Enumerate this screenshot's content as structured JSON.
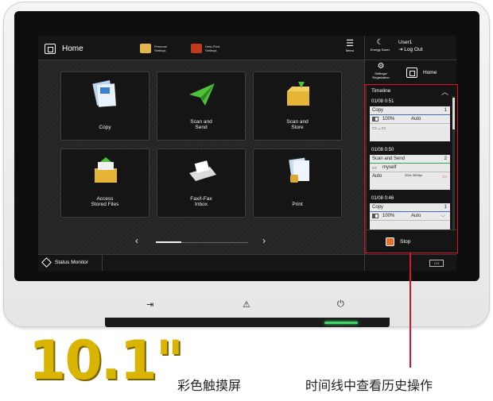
{
  "topbar": {
    "home_label": "Home",
    "personal_settings": "Personal Settings",
    "dest_fwd_settings": "Dest./Fwd. Settings",
    "menu_label": "Menu"
  },
  "session": {
    "energy_saver": "Energy Saver",
    "user": "User1",
    "logout": "Log Out",
    "settings_registration": "Settings/ Registration",
    "home_label": "Home"
  },
  "tiles": [
    {
      "label": "Copy"
    },
    {
      "label": "Scan and\nSend"
    },
    {
      "label": "Scan and\nStore"
    },
    {
      "label": "Access\nStored Files"
    },
    {
      "label": "Fax/I-Fax\nInbox"
    },
    {
      "label": "Print"
    }
  ],
  "timeline": {
    "title": "Timeline",
    "entries": [
      {
        "time": "01/08 0:51",
        "job": "Copy",
        "count": "1",
        "pct": "100%",
        "mode": "Auto"
      },
      {
        "time": "01/08 0:50",
        "job": "Scan and Send",
        "count": "2",
        "dest": "myself",
        "mode": "Auto",
        "res": "200x 300dpi"
      },
      {
        "time": "01/08 0:46",
        "job": "Copy",
        "count": "1",
        "pct": "100%",
        "mode": "Auto"
      }
    ],
    "stop": "Stop"
  },
  "statusbar": {
    "status_monitor": "Status Monitor",
    "counter": "123"
  },
  "hardware": {
    "hw_icons": [
      "login-icon",
      "warning-icon",
      "power-icon"
    ]
  },
  "marketing": {
    "size": "10.1\"",
    "caption_touchscreen": "彩色触摸屏",
    "caption_timeline": "时间线中查看历史操作"
  },
  "colors": {
    "accent_red": "#e0122b",
    "gold": "#d9b400",
    "led_green": "#3fd46a"
  }
}
